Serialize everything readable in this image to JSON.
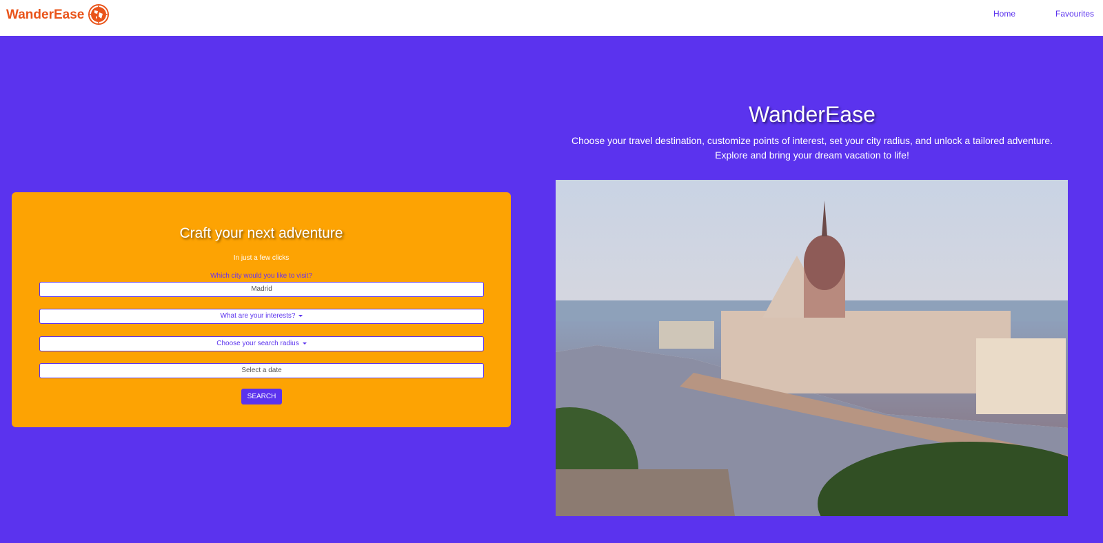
{
  "header": {
    "brand": "WanderEase",
    "nav": {
      "home": "Home",
      "favourites": "Favourites"
    }
  },
  "form": {
    "title": "Craft your next adventure",
    "subtitle": "In just a few clicks",
    "city_question": "Which city would you like to visit?",
    "city_value": "Madrid",
    "interests_label": "What are your interests?",
    "radius_label": "Choose your search radius",
    "date_placeholder": "Select a date",
    "search_label": "SEARCH"
  },
  "hero": {
    "title": "WanderEase",
    "line1": "Choose your travel destination, customize points of interest, set your city radius, and unlock a tailored adventure.",
    "line2": "Explore and bring your dream vacation to life!"
  },
  "colors": {
    "primary": "#5b33ee",
    "accent": "#fda303",
    "brand": "#e9541a"
  }
}
